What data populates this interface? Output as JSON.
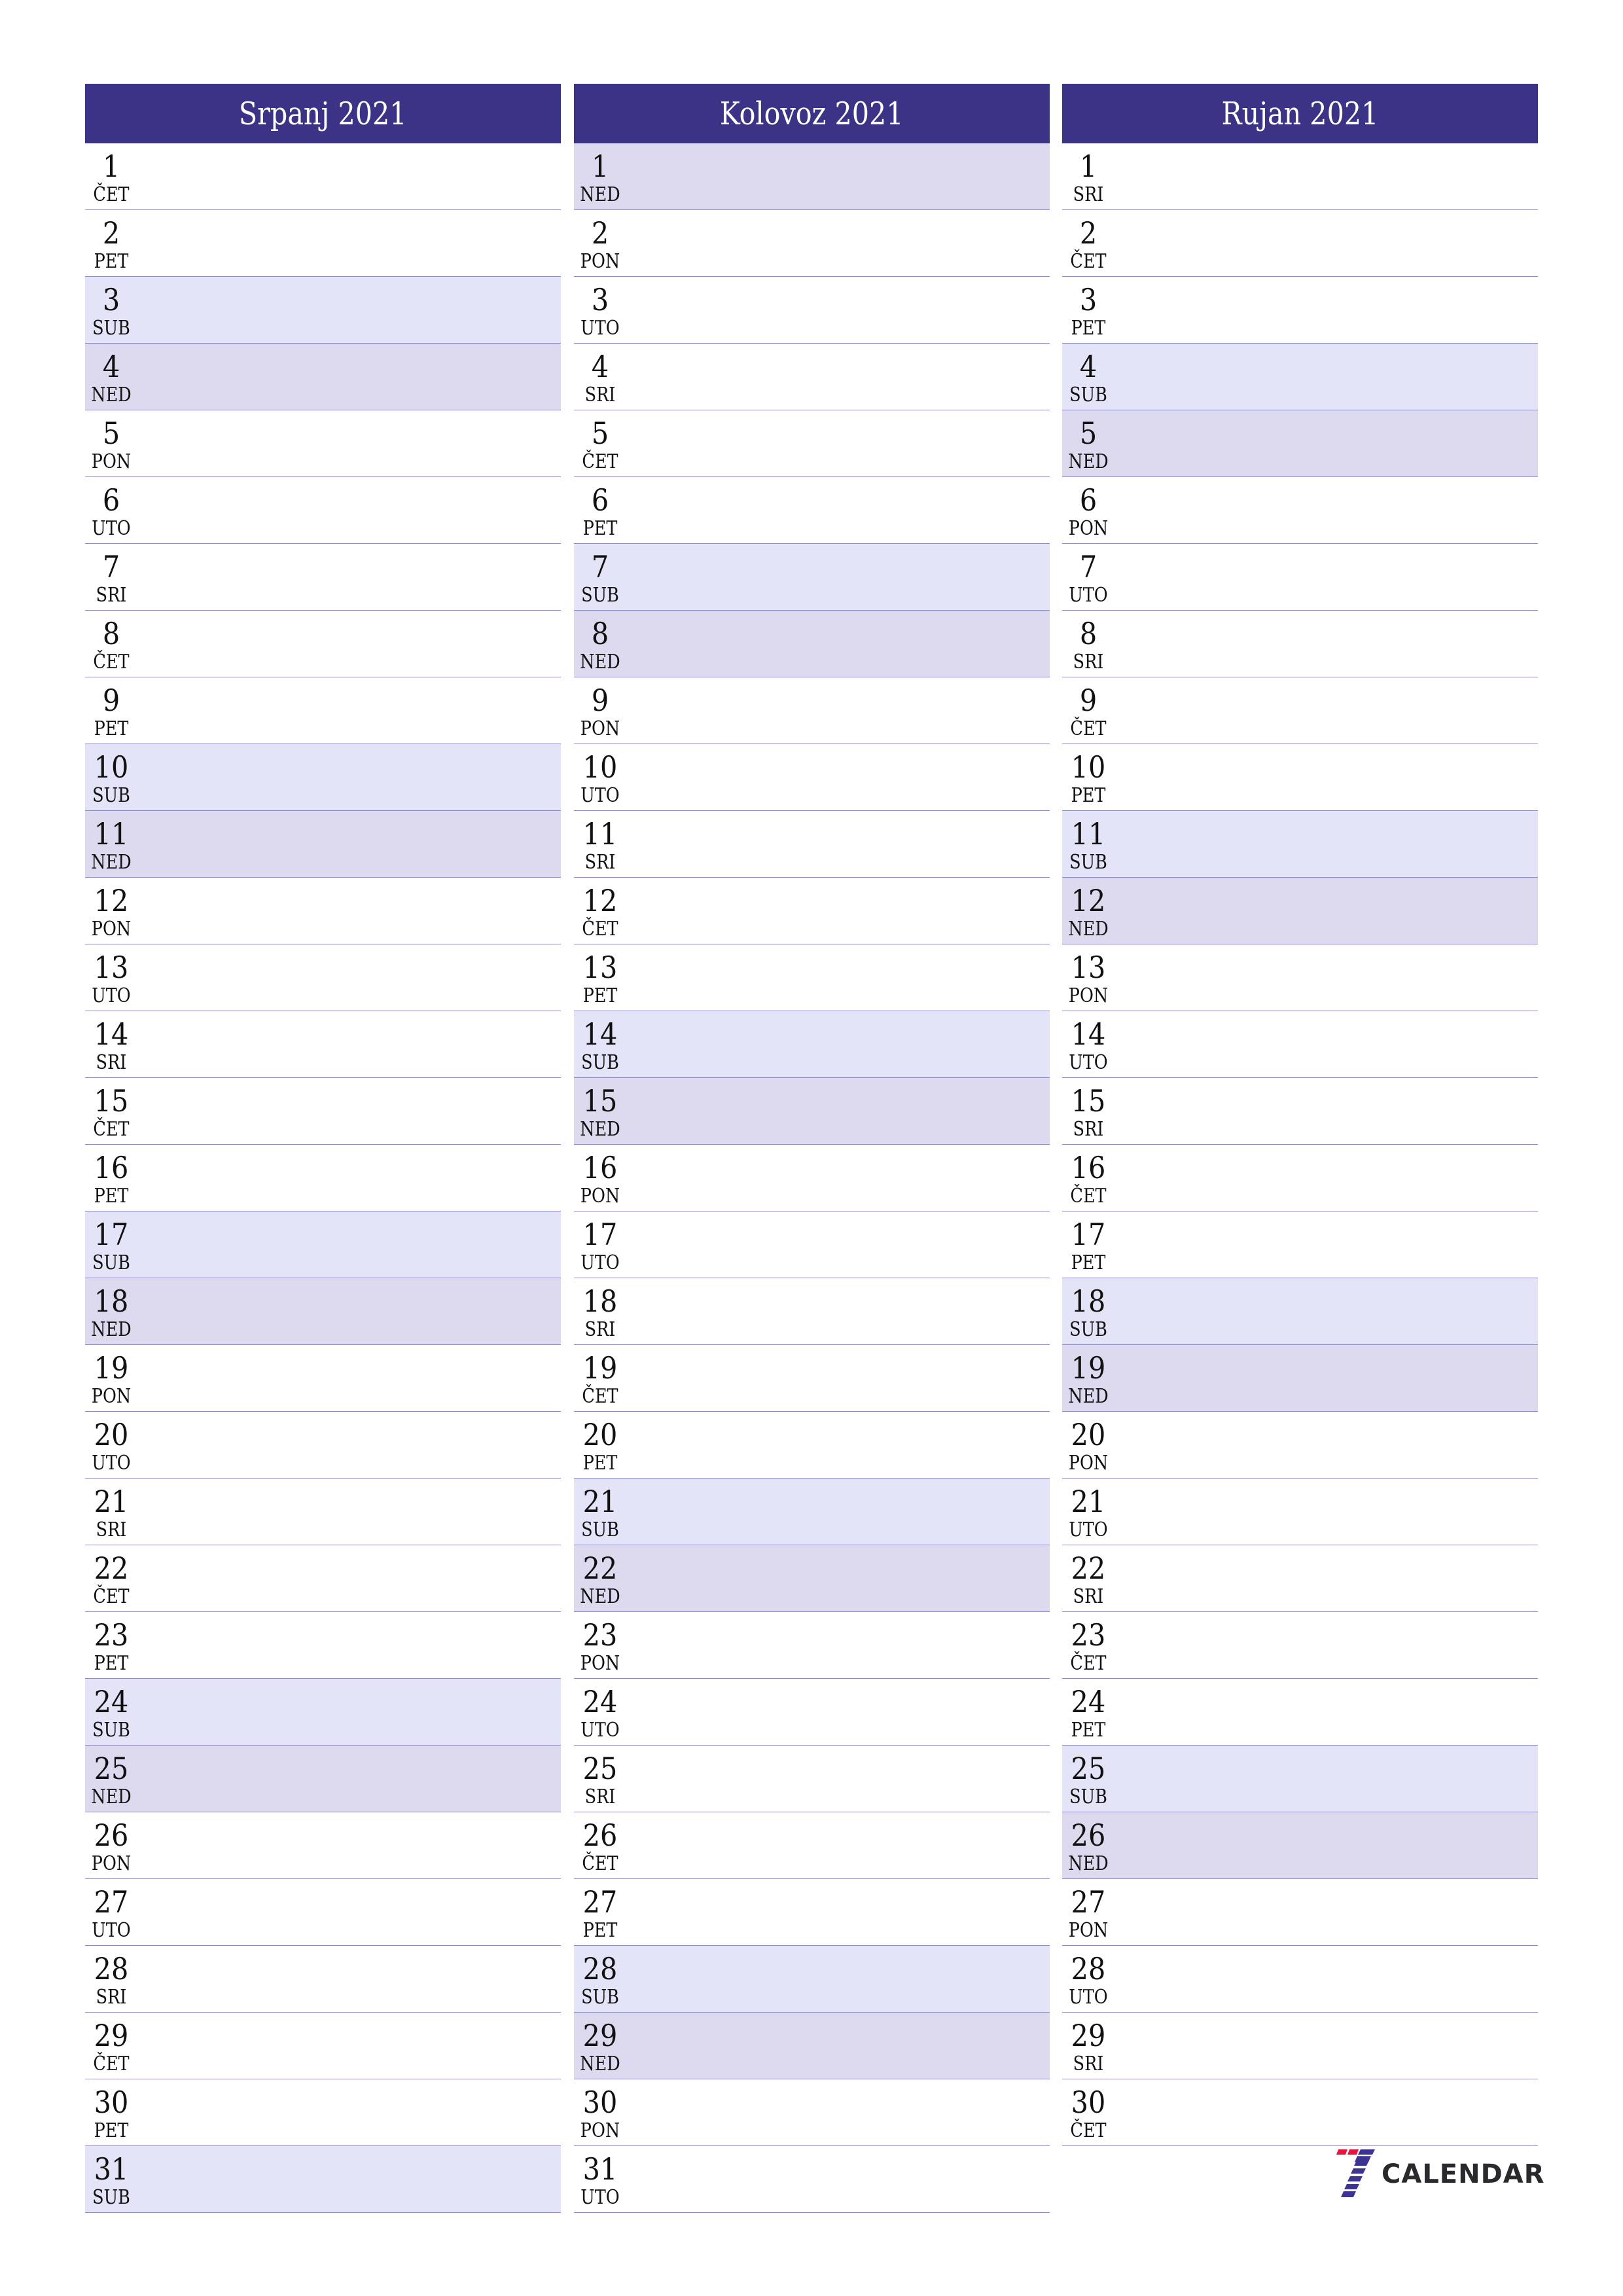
{
  "colors": {
    "header_bg": "#3b3385",
    "saturday_bg": "#e4e4f8",
    "sunday_bg": "#ddd9ef",
    "divider": "#8e8bbf",
    "logo_red": "#e8163f",
    "logo_blue": "#3d3395"
  },
  "months": [
    {
      "title": "Srpanj 2021",
      "days": [
        {
          "n": "1",
          "d": "ČET"
        },
        {
          "n": "2",
          "d": "PET"
        },
        {
          "n": "3",
          "d": "SUB"
        },
        {
          "n": "4",
          "d": "NED"
        },
        {
          "n": "5",
          "d": "PON"
        },
        {
          "n": "6",
          "d": "UTO"
        },
        {
          "n": "7",
          "d": "SRI"
        },
        {
          "n": "8",
          "d": "ČET"
        },
        {
          "n": "9",
          "d": "PET"
        },
        {
          "n": "10",
          "d": "SUB"
        },
        {
          "n": "11",
          "d": "NED"
        },
        {
          "n": "12",
          "d": "PON"
        },
        {
          "n": "13",
          "d": "UTO"
        },
        {
          "n": "14",
          "d": "SRI"
        },
        {
          "n": "15",
          "d": "ČET"
        },
        {
          "n": "16",
          "d": "PET"
        },
        {
          "n": "17",
          "d": "SUB"
        },
        {
          "n": "18",
          "d": "NED"
        },
        {
          "n": "19",
          "d": "PON"
        },
        {
          "n": "20",
          "d": "UTO"
        },
        {
          "n": "21",
          "d": "SRI"
        },
        {
          "n": "22",
          "d": "ČET"
        },
        {
          "n": "23",
          "d": "PET"
        },
        {
          "n": "24",
          "d": "SUB"
        },
        {
          "n": "25",
          "d": "NED"
        },
        {
          "n": "26",
          "d": "PON"
        },
        {
          "n": "27",
          "d": "UTO"
        },
        {
          "n": "28",
          "d": "SRI"
        },
        {
          "n": "29",
          "d": "ČET"
        },
        {
          "n": "30",
          "d": "PET"
        },
        {
          "n": "31",
          "d": "SUB"
        }
      ]
    },
    {
      "title": "Kolovoz 2021",
      "days": [
        {
          "n": "1",
          "d": "NED"
        },
        {
          "n": "2",
          "d": "PON"
        },
        {
          "n": "3",
          "d": "UTO"
        },
        {
          "n": "4",
          "d": "SRI"
        },
        {
          "n": "5",
          "d": "ČET"
        },
        {
          "n": "6",
          "d": "PET"
        },
        {
          "n": "7",
          "d": "SUB"
        },
        {
          "n": "8",
          "d": "NED"
        },
        {
          "n": "9",
          "d": "PON"
        },
        {
          "n": "10",
          "d": "UTO"
        },
        {
          "n": "11",
          "d": "SRI"
        },
        {
          "n": "12",
          "d": "ČET"
        },
        {
          "n": "13",
          "d": "PET"
        },
        {
          "n": "14",
          "d": "SUB"
        },
        {
          "n": "15",
          "d": "NED"
        },
        {
          "n": "16",
          "d": "PON"
        },
        {
          "n": "17",
          "d": "UTO"
        },
        {
          "n": "18",
          "d": "SRI"
        },
        {
          "n": "19",
          "d": "ČET"
        },
        {
          "n": "20",
          "d": "PET"
        },
        {
          "n": "21",
          "d": "SUB"
        },
        {
          "n": "22",
          "d": "NED"
        },
        {
          "n": "23",
          "d": "PON"
        },
        {
          "n": "24",
          "d": "UTO"
        },
        {
          "n": "25",
          "d": "SRI"
        },
        {
          "n": "26",
          "d": "ČET"
        },
        {
          "n": "27",
          "d": "PET"
        },
        {
          "n": "28",
          "d": "SUB"
        },
        {
          "n": "29",
          "d": "NED"
        },
        {
          "n": "30",
          "d": "PON"
        },
        {
          "n": "31",
          "d": "UTO"
        }
      ]
    },
    {
      "title": "Rujan 2021",
      "days": [
        {
          "n": "1",
          "d": "SRI"
        },
        {
          "n": "2",
          "d": "ČET"
        },
        {
          "n": "3",
          "d": "PET"
        },
        {
          "n": "4",
          "d": "SUB"
        },
        {
          "n": "5",
          "d": "NED"
        },
        {
          "n": "6",
          "d": "PON"
        },
        {
          "n": "7",
          "d": "UTO"
        },
        {
          "n": "8",
          "d": "SRI"
        },
        {
          "n": "9",
          "d": "ČET"
        },
        {
          "n": "10",
          "d": "PET"
        },
        {
          "n": "11",
          "d": "SUB"
        },
        {
          "n": "12",
          "d": "NED"
        },
        {
          "n": "13",
          "d": "PON"
        },
        {
          "n": "14",
          "d": "UTO"
        },
        {
          "n": "15",
          "d": "SRI"
        },
        {
          "n": "16",
          "d": "ČET"
        },
        {
          "n": "17",
          "d": "PET"
        },
        {
          "n": "18",
          "d": "SUB"
        },
        {
          "n": "19",
          "d": "NED"
        },
        {
          "n": "20",
          "d": "PON"
        },
        {
          "n": "21",
          "d": "UTO"
        },
        {
          "n": "22",
          "d": "SRI"
        },
        {
          "n": "23",
          "d": "ČET"
        },
        {
          "n": "24",
          "d": "PET"
        },
        {
          "n": "25",
          "d": "SUB"
        },
        {
          "n": "26",
          "d": "NED"
        },
        {
          "n": "27",
          "d": "PON"
        },
        {
          "n": "28",
          "d": "UTO"
        },
        {
          "n": "29",
          "d": "SRI"
        },
        {
          "n": "30",
          "d": "ČET"
        }
      ]
    }
  ],
  "weekend": {
    "saturday": "SUB",
    "sunday": "NED"
  },
  "logo": {
    "icon": "seven-logo-icon",
    "text": "CALENDAR"
  }
}
